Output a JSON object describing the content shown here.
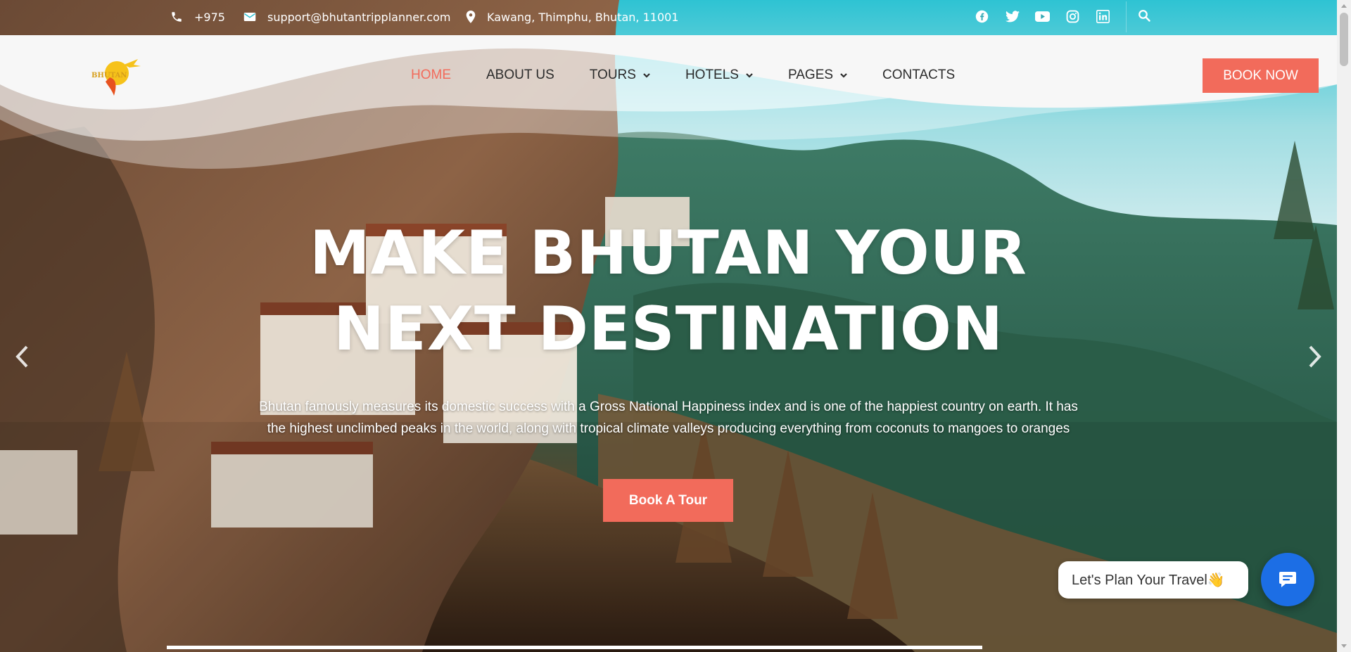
{
  "topbar": {
    "phone": "+975",
    "email": "support@bhutantripplanner.com",
    "address": "Kawang, Thimphu, Bhutan, 11001",
    "social_icons": [
      "facebook-icon",
      "twitter-icon",
      "youtube-icon",
      "instagram-icon",
      "linkedin-icon"
    ]
  },
  "logo": {
    "text": "BHUTAN"
  },
  "nav": {
    "items": [
      {
        "label": "HOME",
        "active": true,
        "dropdown": false
      },
      {
        "label": "ABOUT US",
        "active": false,
        "dropdown": false
      },
      {
        "label": "TOURS",
        "active": false,
        "dropdown": true
      },
      {
        "label": "HOTELS",
        "active": false,
        "dropdown": true
      },
      {
        "label": "PAGES",
        "active": false,
        "dropdown": true
      },
      {
        "label": "CONTACTS",
        "active": false,
        "dropdown": false
      }
    ],
    "book_now": "BOOK NOW"
  },
  "hero": {
    "title_line1": "MAKE BHUTAN YOUR",
    "title_line2": "NEXT DESTINATION",
    "description_line1": "Bhutan famously measures its domestic success with a Gross National Happiness index and is one of the happiest country on earth. It has",
    "description_line2": "the highest unclimbed peaks in the world, along with tropical climate valleys producing everything from coconuts to mangoes to oranges",
    "cta": "Book A Tour"
  },
  "slider": {
    "progress_percent": 61
  },
  "chat": {
    "prompt": "Let's Plan Your Travel👋"
  },
  "colors": {
    "accent": "#f26b5b",
    "chat_button": "#1c6ee5",
    "nav_text": "#2b2b2b"
  }
}
